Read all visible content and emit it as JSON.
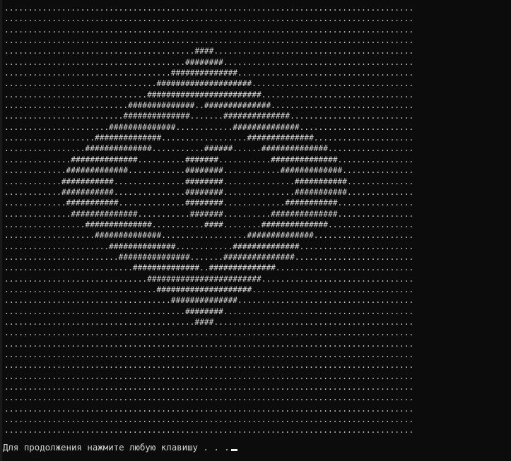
{
  "colors": {
    "background": "#0c0c0c",
    "text": "#d4d4d4",
    "cursor": "#f0f0f0"
  },
  "pattern": {
    "width": 86,
    "fill_char": ".",
    "mark_char": "#",
    "rows": [
      [],
      [],
      [],
      [],
      [
        [
          40,
          4
        ]
      ],
      [
        [
          38,
          8
        ]
      ],
      [
        [
          35,
          14
        ]
      ],
      [
        [
          32,
          20
        ]
      ],
      [
        [
          30,
          24
        ]
      ],
      [
        [
          26,
          14
        ],
        [
          42,
          14
        ]
      ],
      [
        [
          25,
          14
        ],
        [
          46,
          14
        ]
      ],
      [
        [
          22,
          14
        ],
        [
          48,
          14
        ]
      ],
      [
        [
          19,
          14
        ],
        [
          51,
          14
        ]
      ],
      [
        [
          17,
          14
        ],
        [
          42,
          6
        ],
        [
          54,
          14
        ]
      ],
      [
        [
          14,
          14
        ],
        [
          38,
          7
        ],
        [
          56,
          14
        ]
      ],
      [
        [
          13,
          13
        ],
        [
          38,
          8
        ],
        [
          58,
          13
        ]
      ],
      [
        [
          12,
          11
        ],
        [
          38,
          8
        ],
        [
          61,
          11
        ]
      ],
      [
        [
          12,
          11
        ],
        [
          38,
          8
        ],
        [
          61,
          11
        ]
      ],
      [
        [
          13,
          11
        ],
        [
          38,
          8
        ],
        [
          59,
          11
        ]
      ],
      [
        [
          14,
          14
        ],
        [
          39,
          7
        ],
        [
          56,
          14
        ]
      ],
      [
        [
          17,
          14
        ],
        [
          42,
          4
        ],
        [
          54,
          14
        ]
      ],
      [
        [
          19,
          14
        ],
        [
          51,
          14
        ]
      ],
      [
        [
          22,
          14
        ],
        [
          48,
          14
        ]
      ],
      [
        [
          24,
          15
        ],
        [
          46,
          15
        ]
      ],
      [
        [
          27,
          14
        ],
        [
          43,
          14
        ]
      ],
      [
        [
          30,
          24
        ]
      ],
      [
        [
          32,
          20
        ]
      ],
      [
        [
          35,
          14
        ]
      ],
      [
        [
          38,
          8
        ]
      ],
      [
        [
          40,
          4
        ]
      ],
      [],
      [],
      [],
      [],
      [],
      [],
      [],
      [],
      [],
      []
    ]
  },
  "prompt": {
    "text": "Для продолжения нажмите любую клавишу . . ."
  }
}
